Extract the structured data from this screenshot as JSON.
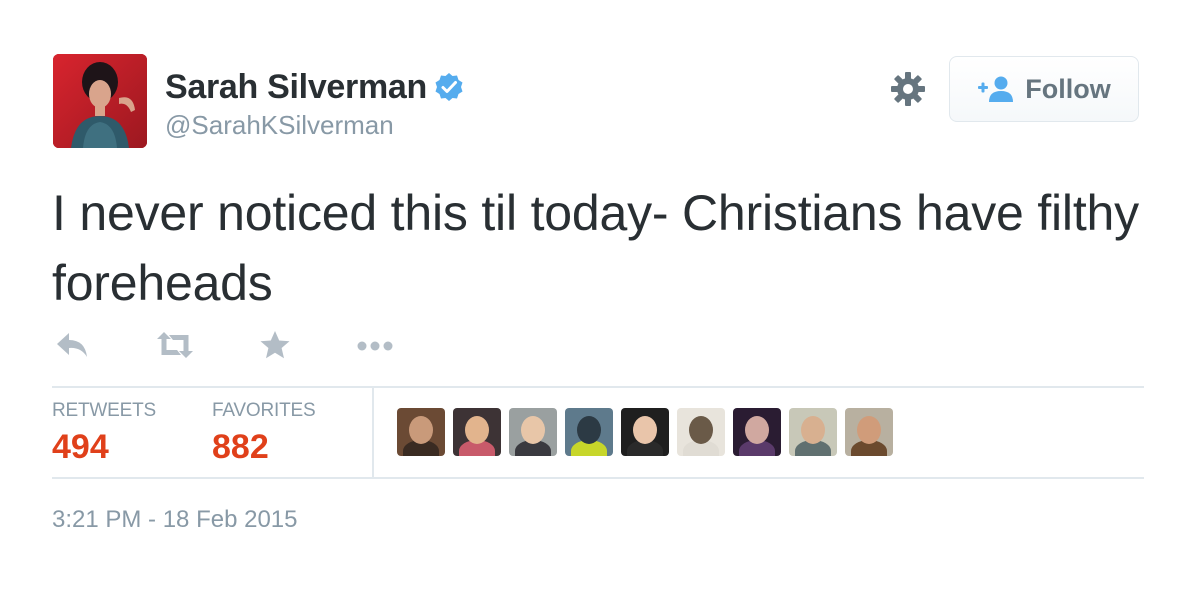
{
  "user": {
    "display_name": "Sarah Silverman",
    "handle": "@SarahKSilverman",
    "verified_icon": "verified-badge-icon",
    "brand_color": "#55acee"
  },
  "header": {
    "settings_icon": "gear-icon",
    "follow_label": "Follow",
    "follow_icon": "add-user-icon"
  },
  "tweet": {
    "text": "I never noticed this til today- Christians have filthy foreheads",
    "timestamp": "3:21 PM - 18 Feb 2015"
  },
  "actions": [
    {
      "name": "reply",
      "icon": "reply-icon"
    },
    {
      "name": "retweet",
      "icon": "retweet-icon"
    },
    {
      "name": "favorite",
      "icon": "star-icon"
    },
    {
      "name": "more",
      "icon": "more-icon"
    }
  ],
  "stats": {
    "retweets_label": "RETWEETS",
    "retweets_count": "494",
    "favorites_label": "FAVORITES",
    "favorites_count": "882",
    "count_color": "#e0401a"
  },
  "favorited_by": [
    {
      "bg": "#6b4a34",
      "face": "#c99a7a",
      "body": "#3a2b22"
    },
    {
      "bg": "#3d3335",
      "face": "#e2b48d",
      "body": "#c85a6a"
    },
    {
      "bg": "#9aa0a0",
      "face": "#e8c6a8",
      "body": "#3a3a40"
    },
    {
      "bg": "#5e7a8c",
      "face": "#2c3a44",
      "body": "#c7d62a"
    },
    {
      "bg": "#1f1f1f",
      "face": "#e9c5aa",
      "body": "#2a2a2a"
    },
    {
      "bg": "#e8e4dc",
      "face": "#6a5a48",
      "body": "#e0dcd4"
    },
    {
      "bg": "#2a1c32",
      "face": "#d0a8a0",
      "body": "#5a3a6a"
    },
    {
      "bg": "#c8c8b8",
      "face": "#d8b090",
      "body": "#607070"
    },
    {
      "bg": "#b8b0a0",
      "face": "#d09c7a",
      "body": "#6b4a2e"
    }
  ]
}
